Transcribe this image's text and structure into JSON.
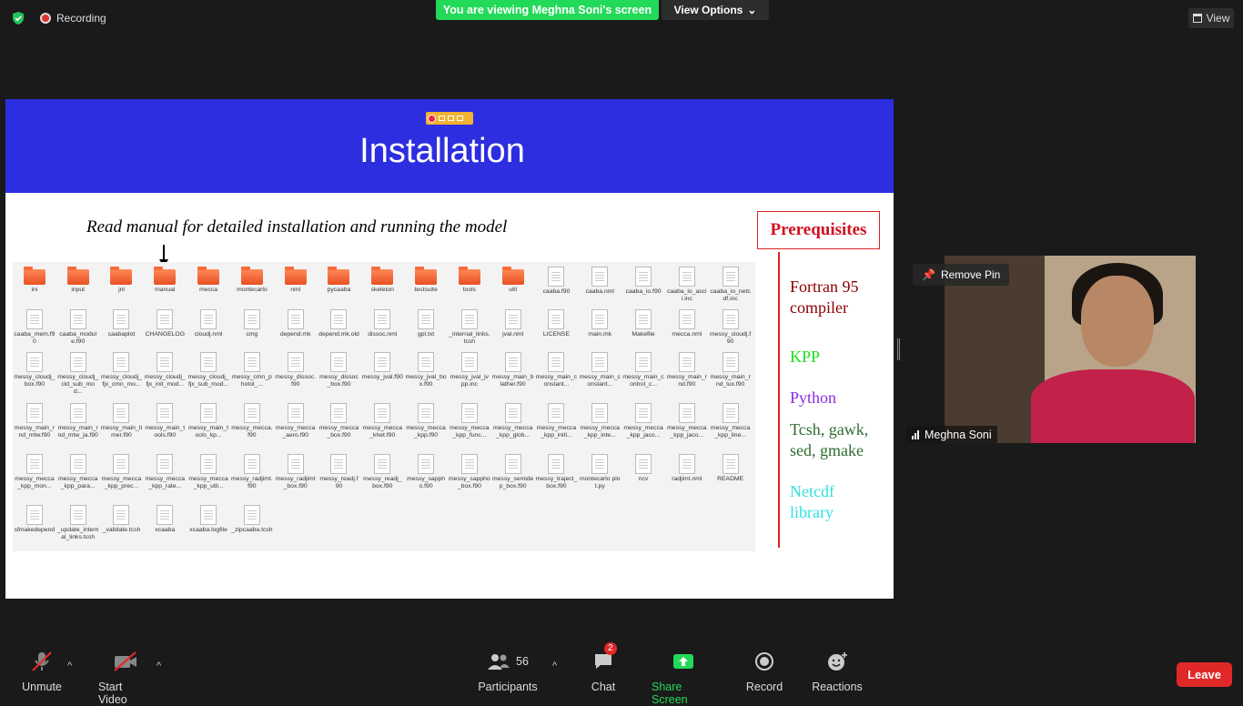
{
  "topbar": {
    "recording_label": "Recording",
    "viewing_banner": "You are viewing Meghna Soni's screen",
    "view_options": "View Options",
    "view_label": "View"
  },
  "slide": {
    "title": "Installation",
    "subtitle": "Read manual for detailed installation and running the model",
    "prereq_title": "Prerequisites",
    "prerequisites": [
      {
        "text": "Fortran 95 compiler",
        "color": "#8b0000"
      },
      {
        "text": "KPP",
        "color": "#19e019"
      },
      {
        "text": "Python",
        "color": "#8a2be2"
      },
      {
        "text": "Tcsh, gawk, sed, gmake",
        "color": "#2f6b2f"
      },
      {
        "text": "Netcdf library",
        "color": "#33e0e0"
      }
    ],
    "files": [
      {
        "name": "ini",
        "type": "folder"
      },
      {
        "name": "input",
        "type": "folder"
      },
      {
        "name": "jnl",
        "type": "folder"
      },
      {
        "name": "manual",
        "type": "folder"
      },
      {
        "name": "mecca",
        "type": "folder"
      },
      {
        "name": "montecarlo",
        "type": "folder"
      },
      {
        "name": "nml",
        "type": "folder"
      },
      {
        "name": "pycaaba",
        "type": "folder"
      },
      {
        "name": "skeleton",
        "type": "folder"
      },
      {
        "name": "testsuite",
        "type": "folder"
      },
      {
        "name": "tools",
        "type": "folder"
      },
      {
        "name": "util",
        "type": "folder"
      },
      {
        "name": "caaba.f90",
        "type": "doc"
      },
      {
        "name": "caaba.nml",
        "type": "doc"
      },
      {
        "name": "caaba_io.f90",
        "type": "doc"
      },
      {
        "name": "caaba_io_ascii.inc",
        "type": "doc"
      },
      {
        "name": "caaba_io_netcdf.inc",
        "type": "doc"
      },
      {
        "name": "caaba_mem.f90",
        "type": "doc"
      },
      {
        "name": "caaba_module.f90",
        "type": "doc"
      },
      {
        "name": "caabaplot",
        "type": "doc"
      },
      {
        "name": "CHANGELOG",
        "type": "doc"
      },
      {
        "name": "cloudj.nml",
        "type": "doc"
      },
      {
        "name": "cmg",
        "type": "doc"
      },
      {
        "name": "depend.mk",
        "type": "doc"
      },
      {
        "name": "depend.mk.old",
        "type": "doc"
      },
      {
        "name": "dissoc.nml",
        "type": "doc"
      },
      {
        "name": "gpl.txt",
        "type": "doc"
      },
      {
        "name": "_internal_links.tcsh",
        "type": "doc"
      },
      {
        "name": "jval.nml",
        "type": "doc"
      },
      {
        "name": "LICENSE",
        "type": "doc"
      },
      {
        "name": "main.mk",
        "type": "doc"
      },
      {
        "name": "Makefile",
        "type": "doc"
      },
      {
        "name": "mecca.nml",
        "type": "doc"
      },
      {
        "name": "messy_cloudj.f90",
        "type": "doc"
      },
      {
        "name": "messy_cloudj_box.f90",
        "type": "doc"
      },
      {
        "name": "messy_cloudj_cld_sub_mod...",
        "type": "doc"
      },
      {
        "name": "messy_cloudj_fjx_cmn_mo...",
        "type": "doc"
      },
      {
        "name": "messy_cloudj_fjx_init_mod...",
        "type": "doc"
      },
      {
        "name": "messy_cloudj_fjx_sub_mod...",
        "type": "doc"
      },
      {
        "name": "messy_cmn_photol_...",
        "type": "doc"
      },
      {
        "name": "messy_dissoc.f90",
        "type": "doc"
      },
      {
        "name": "messy_dissoc_box.f90",
        "type": "doc"
      },
      {
        "name": "messy_jval.f90",
        "type": "doc"
      },
      {
        "name": "messy_jval_box.f90",
        "type": "doc"
      },
      {
        "name": "messy_jval_jvpp.inc",
        "type": "doc"
      },
      {
        "name": "messy_main_blather.f90",
        "type": "doc"
      },
      {
        "name": "messy_main_constant...",
        "type": "doc"
      },
      {
        "name": "messy_main_constant...",
        "type": "doc"
      },
      {
        "name": "messy_main_control_c...",
        "type": "doc"
      },
      {
        "name": "messy_main_rnd.f90",
        "type": "doc"
      },
      {
        "name": "messy_main_rnd_lux.f90",
        "type": "doc"
      },
      {
        "name": "messy_main_rnd_mtw.f90",
        "type": "doc"
      },
      {
        "name": "messy_main_rnd_mtw_ja.f90",
        "type": "doc"
      },
      {
        "name": "messy_main_timer.f90",
        "type": "doc"
      },
      {
        "name": "messy_main_tools.f90",
        "type": "doc"
      },
      {
        "name": "messy_main_tools_kp...",
        "type": "doc"
      },
      {
        "name": "messy_mecca.f90",
        "type": "doc"
      },
      {
        "name": "messy_mecca_aero.f90",
        "type": "doc"
      },
      {
        "name": "messy_mecca_box.f90",
        "type": "doc"
      },
      {
        "name": "messy_mecca_khet.f90",
        "type": "doc"
      },
      {
        "name": "messy_mecca_kpp.f90",
        "type": "doc"
      },
      {
        "name": "messy_mecca_kpp_func...",
        "type": "doc"
      },
      {
        "name": "messy_mecca_kpp_glob...",
        "type": "doc"
      },
      {
        "name": "messy_mecca_kpp_initi...",
        "type": "doc"
      },
      {
        "name": "messy_mecca_kpp_inte...",
        "type": "doc"
      },
      {
        "name": "messy_mecca_kpp_jaco...",
        "type": "doc"
      },
      {
        "name": "messy_mecca_kpp_jaco...",
        "type": "doc"
      },
      {
        "name": "messy_mecca_kpp_line...",
        "type": "doc"
      },
      {
        "name": "messy_mecca_kpp_mon...",
        "type": "doc"
      },
      {
        "name": "messy_mecca_kpp_para...",
        "type": "doc"
      },
      {
        "name": "messy_mecca_kpp_prec...",
        "type": "doc"
      },
      {
        "name": "messy_mecca_kpp_rate...",
        "type": "doc"
      },
      {
        "name": "messy_mecca_kpp_util...",
        "type": "doc"
      },
      {
        "name": "messy_radjimt.f90",
        "type": "doc"
      },
      {
        "name": "messy_radjimt_box.f90",
        "type": "doc"
      },
      {
        "name": "messy_readj.f90",
        "type": "doc"
      },
      {
        "name": "messy_readj_box.f90",
        "type": "doc"
      },
      {
        "name": "messy_sappho.f90",
        "type": "doc"
      },
      {
        "name": "messy_sappho_box.f90",
        "type": "doc"
      },
      {
        "name": "messy_semidep_box.f90",
        "type": "doc"
      },
      {
        "name": "messy_traject_box.f90",
        "type": "doc"
      },
      {
        "name": "montecarlo plot.py",
        "type": "doc"
      },
      {
        "name": "ncv",
        "type": "doc"
      },
      {
        "name": "radjimt.nml",
        "type": "doc"
      },
      {
        "name": "README",
        "type": "doc"
      },
      {
        "name": "sfmakedepend",
        "type": "doc"
      },
      {
        "name": "_update_internal_links.tcsh",
        "type": "doc"
      },
      {
        "name": "_validate.tcsh",
        "type": "doc"
      },
      {
        "name": "xcaaba",
        "type": "doc"
      },
      {
        "name": "xcaaba.logfile",
        "type": "doc"
      },
      {
        "name": "_zipcaaba.tcsh",
        "type": "doc"
      }
    ]
  },
  "video": {
    "remove_pin": "Remove Pin",
    "participant_name": "Meghna Soni"
  },
  "toolbar": {
    "unmute": "Unmute",
    "start_video": "Start Video",
    "participants": "Participants",
    "participant_count": "56",
    "chat": "Chat",
    "chat_badge": "2",
    "share_screen": "Share Screen",
    "record": "Record",
    "reactions": "Reactions",
    "leave": "Leave"
  },
  "colors": {
    "share_green": "#23d959",
    "leave_red": "#e02828",
    "slide_header_blue": "#2d2ee0"
  }
}
